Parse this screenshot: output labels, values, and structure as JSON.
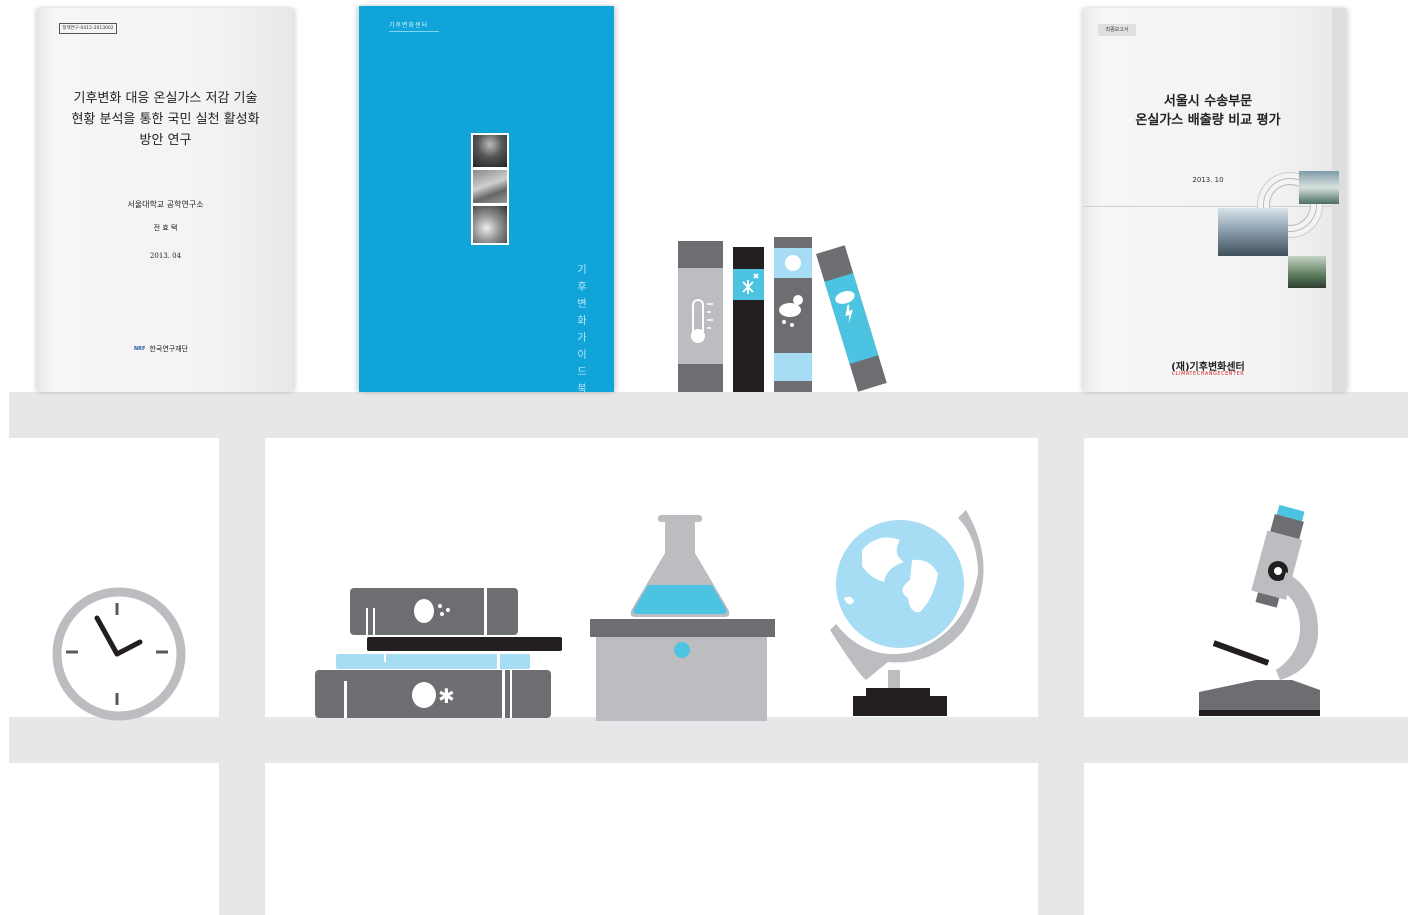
{
  "book1": {
    "code": "정책연구-0415-2013002",
    "title_lines": [
      "기후변화 대응 온실가스 저감 기술",
      "현황 분석을 통한 국민 실천 활성화",
      "방안 연구"
    ],
    "institute": "서울대학교 공학연구소",
    "author": "전 효 택",
    "date": "2013. 04",
    "publisher": "한국연구재단",
    "logo_text": "NRF"
  },
  "book2": {
    "top_label": "기후변화센터",
    "spine_text": "기후변화 가이드북"
  },
  "book3": {
    "badge": "최종보고서",
    "title_lines": [
      "서울시 수송부문",
      "온실가스 배출량 비교 평가"
    ],
    "date": "2013. 10",
    "publisher": "(재)기후변화센터",
    "publisher_en": "CLIMATECHANGECENTER"
  },
  "colors": {
    "shelf": "#e6e7e9",
    "dark_gray": "#6d6e71",
    "mid_gray": "#bcbdc0",
    "black": "#231f20",
    "cyan": "#4cc3e0",
    "light_blue": "#a6ddf5",
    "blue_book": "#11a4d9"
  },
  "icons": [
    "thermometer-icon",
    "snowflake-icon",
    "weather-icon",
    "lightning-icon",
    "clock-icon",
    "book-stack-icon",
    "flask-icon",
    "globe-icon",
    "microscope-icon"
  ]
}
